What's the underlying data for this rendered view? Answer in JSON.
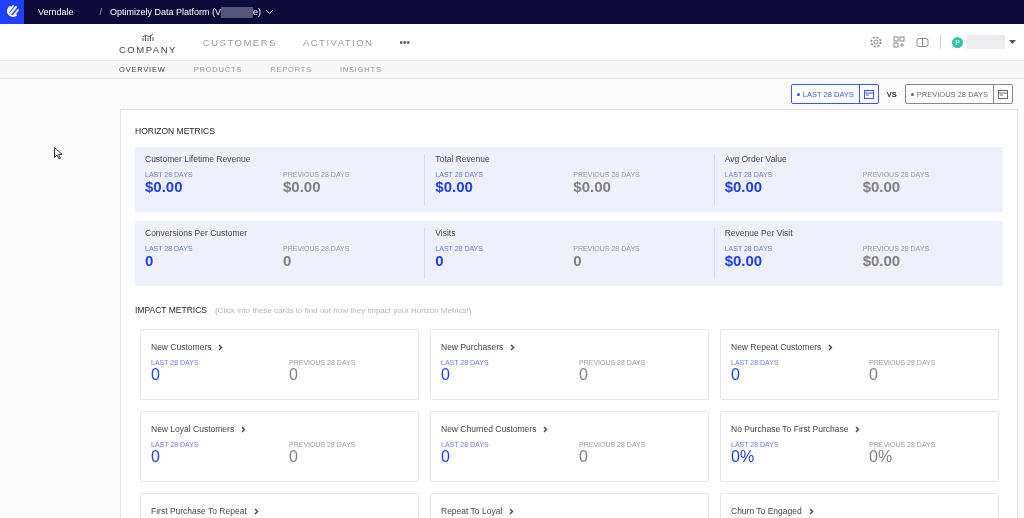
{
  "top_bar": {
    "org": "Verndale",
    "separator": "/",
    "project_start": "Optimizely Data Platform (V",
    "project_end": "e)"
  },
  "nav": {
    "items": [
      {
        "label": "COMPANY",
        "selected": true
      },
      {
        "label": "CUSTOMERS",
        "selected": false
      },
      {
        "label": "ACTIVATION",
        "selected": false
      }
    ],
    "more": "•••"
  },
  "user": {
    "initial": "P"
  },
  "sub_tabs": [
    {
      "label": "OVERVIEW",
      "selected": true
    },
    {
      "label": "PRODUCTS",
      "selected": false
    },
    {
      "label": "REPORTS",
      "selected": false
    },
    {
      "label": "INSIGHTS",
      "selected": false
    }
  ],
  "date_range": {
    "current": "LAST 28 DAYS",
    "vs": "VS",
    "previous": "PREVIOUS 28 DAYS"
  },
  "horizon": {
    "title": "HORIZON METRICS",
    "rows": [
      [
        {
          "name": "Customer Lifetime Revenue",
          "current_label": "LAST 28 DAYS",
          "current": "$0.00",
          "previous_label": "PREVIOUS 28 DAYS",
          "previous": "$0.00"
        },
        {
          "name": "Total Revenue",
          "current_label": "LAST 28 DAYS",
          "current": "$0.00",
          "previous_label": "PREVIOUS 28 DAYS",
          "previous": "$0.00"
        },
        {
          "name": "Avg Order Value",
          "current_label": "LAST 28 DAYS",
          "current": "$0.00",
          "previous_label": "PREVIOUS 28 DAYS",
          "previous": "$0.00"
        }
      ],
      [
        {
          "name": "Conversions Per Customer",
          "current_label": "LAST 28 DAYS",
          "current": "0",
          "previous_label": "PREVIOUS 28 DAYS",
          "previous": "0"
        },
        {
          "name": "Visits",
          "current_label": "LAST 28 DAYS",
          "current": "0",
          "previous_label": "PREVIOUS 28 DAYS",
          "previous": "0"
        },
        {
          "name": "Revenue Per Visit",
          "current_label": "LAST 28 DAYS",
          "current": "$0.00",
          "previous_label": "PREVIOUS 28 DAYS",
          "previous": "$0.00"
        }
      ]
    ]
  },
  "impact": {
    "title": "IMPACT METRICS",
    "hint": "(Click into these cards to find out how they impact your Horizon Metrics!)",
    "cards": [
      {
        "name": "New Customers",
        "current_label": "LAST 28 DAYS",
        "current": "0",
        "previous_label": "PREVIOUS 28 DAYS",
        "previous": "0"
      },
      {
        "name": "New Purchasers",
        "current_label": "LAST 28 DAYS",
        "current": "0",
        "previous_label": "PREVIOUS 28 DAYS",
        "previous": "0"
      },
      {
        "name": "New Repeat Customers",
        "current_label": "LAST 28 DAYS",
        "current": "0",
        "previous_label": "PREVIOUS 28 DAYS",
        "previous": "0"
      },
      {
        "name": "New Loyal Customers",
        "current_label": "LAST 28 DAYS",
        "current": "0",
        "previous_label": "PREVIOUS 28 DAYS",
        "previous": "0"
      },
      {
        "name": "New Churned Customers",
        "current_label": "LAST 28 DAYS",
        "current": "0",
        "previous_label": "PREVIOUS 28 DAYS",
        "previous": "0"
      },
      {
        "name": "No Purchase To First Purchase",
        "current_label": "LAST 28 DAYS",
        "current": "0%",
        "previous_label": "PREVIOUS 28 DAYS",
        "previous": "0%"
      },
      {
        "name": "First Purchase To Repeat"
      },
      {
        "name": "Repeat To Loyal"
      },
      {
        "name": "Churn To Engaged"
      }
    ]
  }
}
